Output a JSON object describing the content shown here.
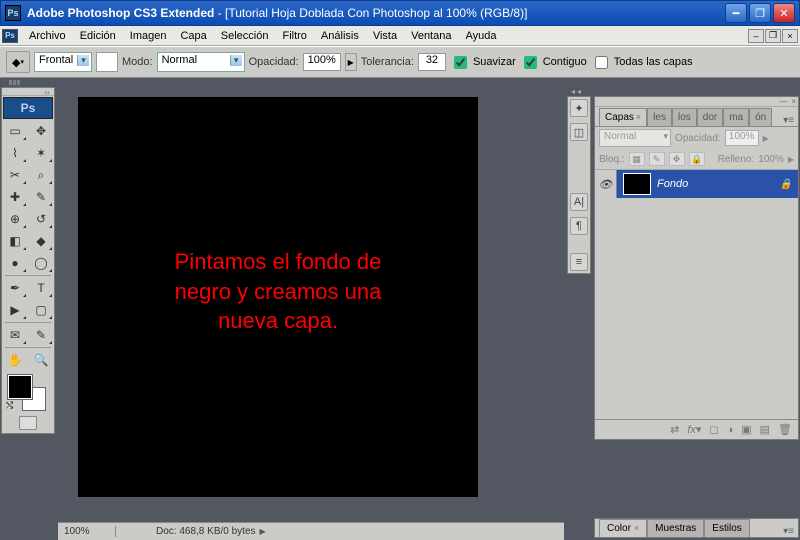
{
  "title": {
    "app": "Adobe Photoshop CS3 Extended",
    "doc": "[Tutorial Hoja Doblada Con Photoshop al 100% (RGB/8)]"
  },
  "menu": [
    "Archivo",
    "Edición",
    "Imagen",
    "Capa",
    "Selección",
    "Filtro",
    "Análisis",
    "Vista",
    "Ventana",
    "Ayuda"
  ],
  "options": {
    "view_label": "Frontal",
    "mode_label": "Modo:",
    "mode_value": "Normal",
    "opacity_label": "Opacidad:",
    "opacity_value": "100%",
    "tolerance_label": "Tolerancia:",
    "tolerance_value": "32",
    "antialias": "Suavizar",
    "contiguous": "Contiguo",
    "all_layers": "Todas las capas"
  },
  "canvas_text": {
    "l1": "Pintamos el fondo de",
    "l2": "negro y creamos una",
    "l3": "nueva capa."
  },
  "status": {
    "zoom": "100%",
    "doc": "Doc: 468,8 KB/0 bytes"
  },
  "layers_panel": {
    "tab_layers": "Capas",
    "tab_channels": "les",
    "tab_paths": "los",
    "tab_history": "dor",
    "tab_actions": "ma",
    "tab_info": "ón",
    "blend_mode": "Normal",
    "opacity_label": "Opacidad:",
    "opacity_value": "100%",
    "lock_label": "Bloq.:",
    "fill_label": "Relleno:",
    "fill_value": "100%",
    "layer_name": "Fondo"
  },
  "color_panel": {
    "tab_color": "Color",
    "tab_swatches": "Muestras",
    "tab_styles": "Estilos"
  }
}
